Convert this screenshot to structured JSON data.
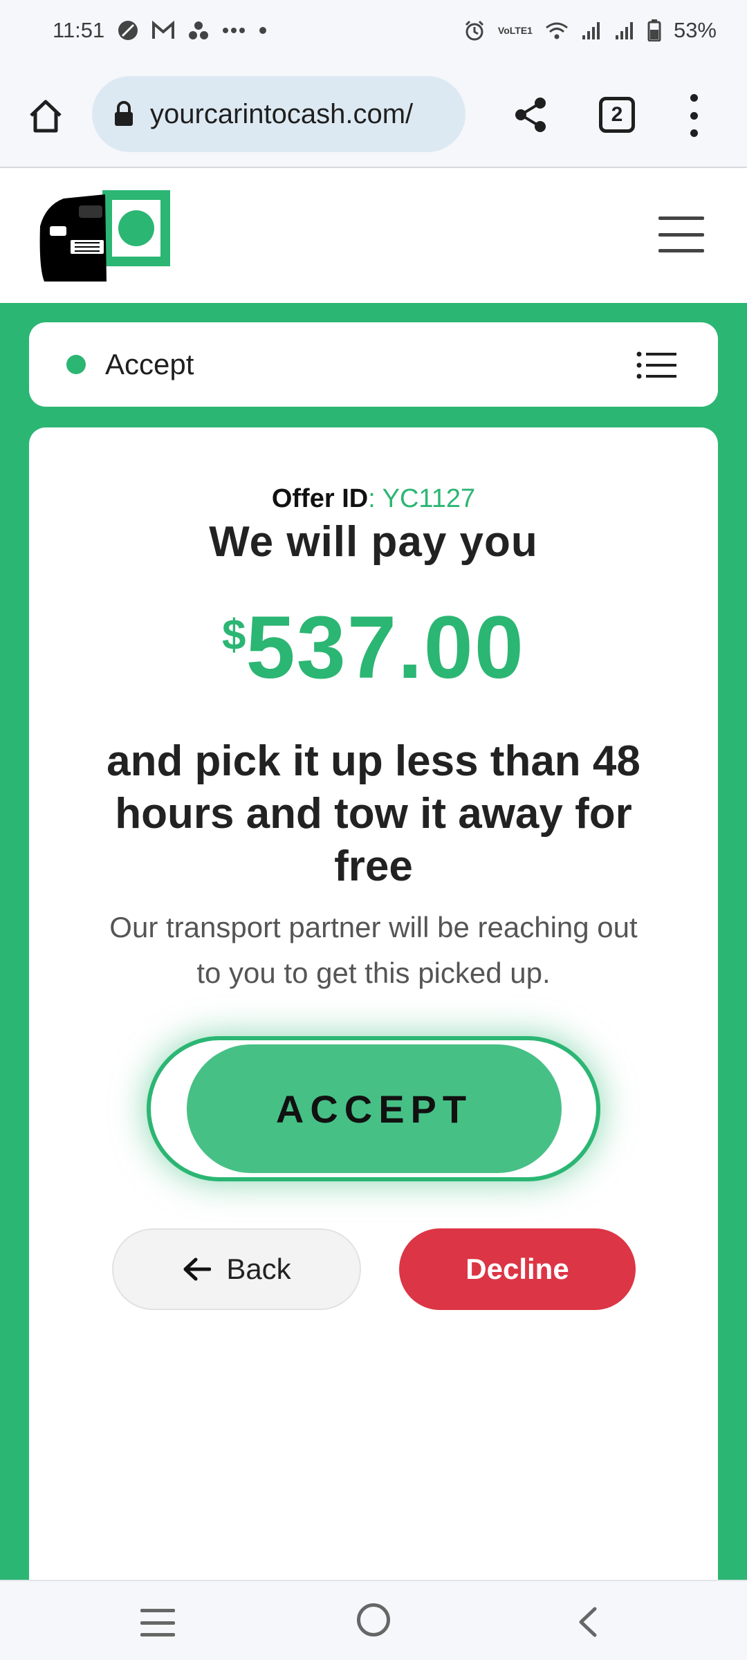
{
  "status_bar": {
    "time": "11:51",
    "battery": "53%",
    "lte_label": "VoLTE1"
  },
  "browser": {
    "url": "yourcarintocash.com/",
    "tab_count": "2"
  },
  "offer_status": {
    "label": "Accept"
  },
  "offer": {
    "id_label": "Offer ID",
    "id_separator": ": ",
    "id_value": "YC1127",
    "headline": "We will pay you",
    "currency_symbol": "$",
    "amount": "537.00",
    "subhead": "and pick it up less than 48 hours and tow it away for free",
    "description": "Our transport partner will be reaching out to you to get this picked up."
  },
  "buttons": {
    "accept_label": "ACCEPT",
    "back_label": "Back",
    "decline_label": "Decline"
  },
  "colors": {
    "brand_green": "#2bb673",
    "decline_red": "#dc3545"
  }
}
